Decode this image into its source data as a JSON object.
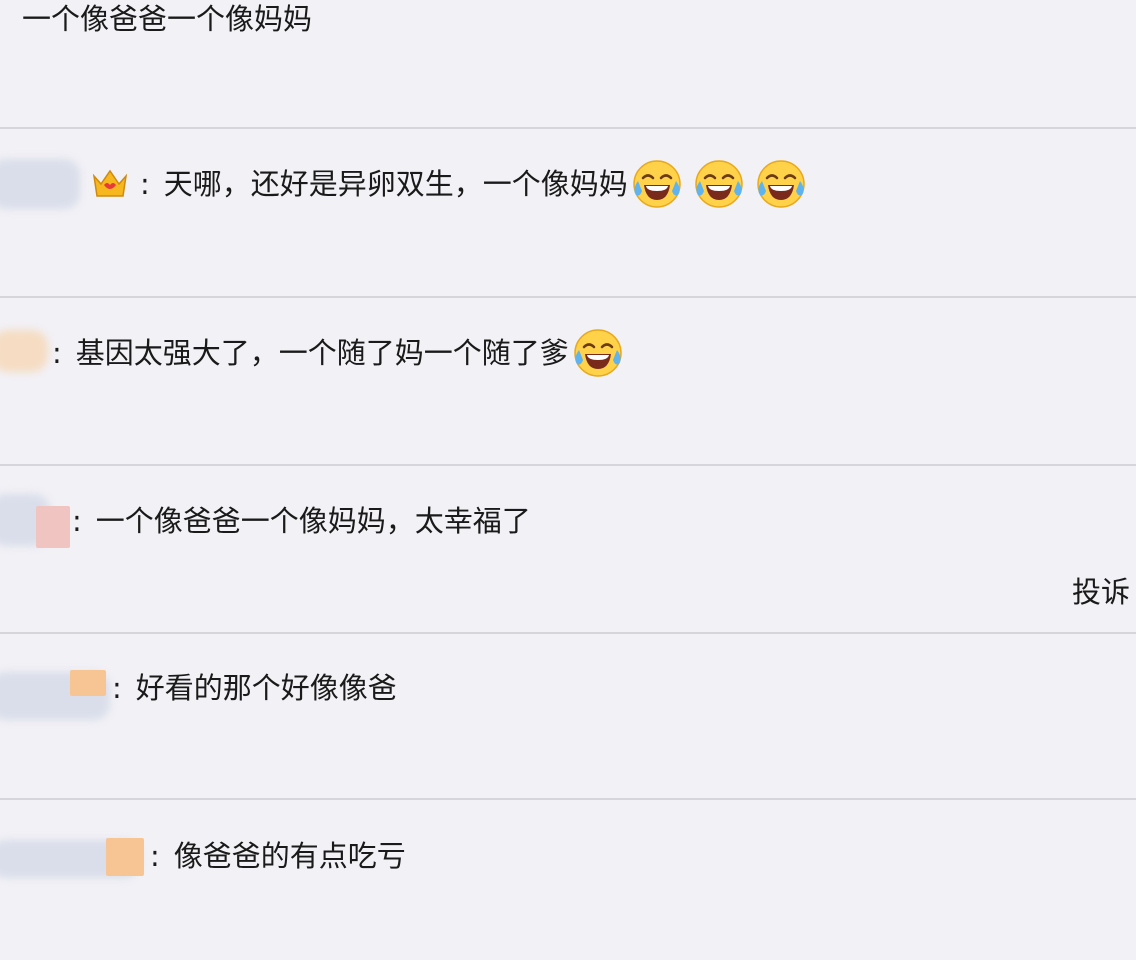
{
  "comments": [
    {
      "text": "一个像爸爸一个像妈妈"
    },
    {
      "text": "天哪，还好是异卵双生，一个像妈妈",
      "emojis": [
        "laughing-crying",
        "laughing-crying",
        "laughing-crying"
      ]
    },
    {
      "text": "基因太强大了，一个随了妈一个随了爹",
      "emojis": [
        "laughing-crying"
      ]
    },
    {
      "text": "一个像爸爸一个像妈妈，太幸福了",
      "action": "投诉"
    },
    {
      "text": "好看的那个好像像爸"
    },
    {
      "text": "像爸爸的有点吃亏"
    }
  ],
  "separator": ":",
  "icons": {
    "crown": "crown-icon",
    "laugh": "laughing-crying-emoji"
  },
  "colors": {
    "background": "#f2f1f6",
    "divider": "#d6d5db",
    "text": "#1a1a1a"
  }
}
